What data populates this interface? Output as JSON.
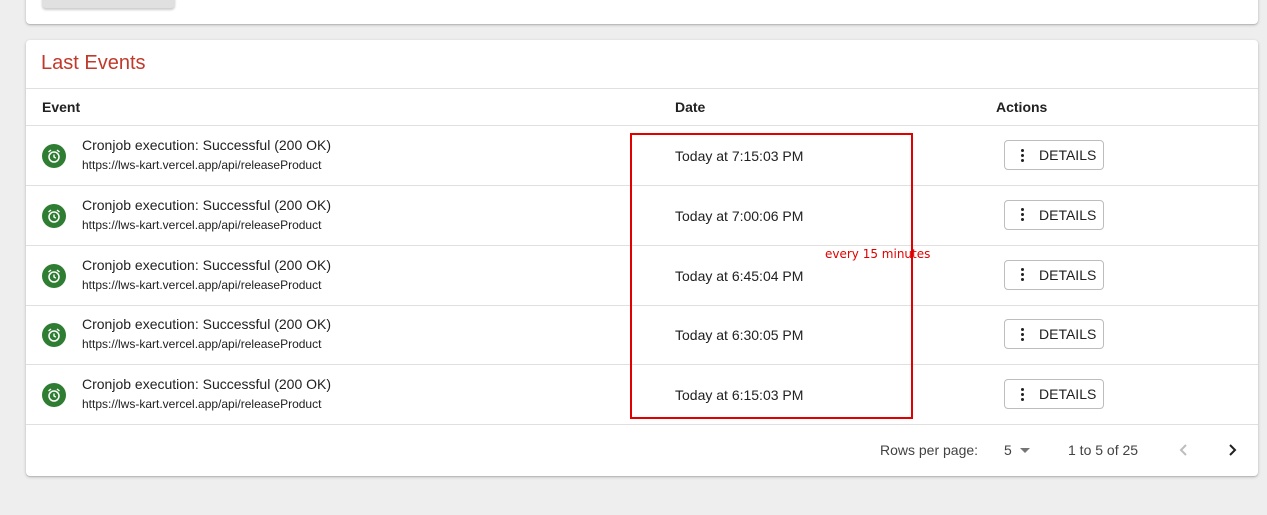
{
  "card": {
    "title": "Last Events"
  },
  "table": {
    "headers": {
      "event": "Event",
      "date": "Date",
      "actions": "Actions"
    },
    "rows": [
      {
        "title": "Cronjob execution: Successful (200 OK)",
        "url": "https://lws-kart.vercel.app/api/releaseProduct",
        "date": "Today at 7:15:03 PM",
        "action": "DETAILS"
      },
      {
        "title": "Cronjob execution: Successful (200 OK)",
        "url": "https://lws-kart.vercel.app/api/releaseProduct",
        "date": "Today at 7:00:06 PM",
        "action": "DETAILS"
      },
      {
        "title": "Cronjob execution: Successful (200 OK)",
        "url": "https://lws-kart.vercel.app/api/releaseProduct",
        "date": "Today at 6:45:04 PM",
        "action": "DETAILS"
      },
      {
        "title": "Cronjob execution: Successful (200 OK)",
        "url": "https://lws-kart.vercel.app/api/releaseProduct",
        "date": "Today at 6:30:05 PM",
        "action": "DETAILS"
      },
      {
        "title": "Cronjob execution: Successful (200 OK)",
        "url": "https://lws-kart.vercel.app/api/releaseProduct",
        "date": "Today at 6:15:03 PM",
        "action": "DETAILS"
      }
    ]
  },
  "pagination": {
    "rows_per_page_label": "Rows per page:",
    "rows_per_page": "5",
    "range": "1 to 5 of 25"
  },
  "annotation": {
    "text": "every 15 minutes",
    "color": "#e00000"
  },
  "colors": {
    "title": "#c0392b",
    "success_icon": "#2e7d32"
  },
  "icons": {
    "row_status": "alarm-clock-icon",
    "action_menu": "more-vert-icon",
    "prev": "chevron-left-icon",
    "next": "chevron-right-icon"
  }
}
